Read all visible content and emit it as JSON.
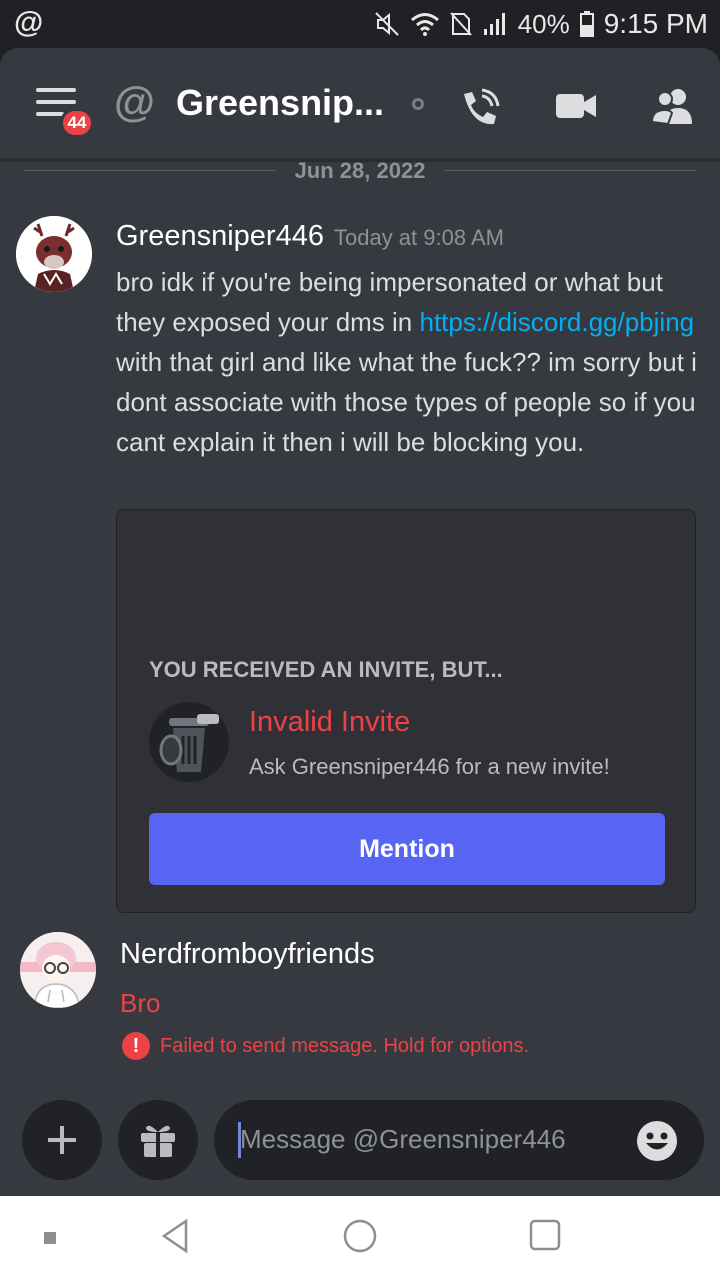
{
  "status_bar": {
    "app_icon": "@",
    "battery": "40%",
    "time": "9:15 PM",
    "icons": [
      "mute-icon",
      "wifi-icon",
      "no-sim-icon",
      "signal-icon",
      "battery-icon"
    ]
  },
  "header": {
    "menu_badge": "44",
    "at_symbol": "@",
    "title": "Greensnip...",
    "icons": [
      "call-icon",
      "video-icon",
      "members-icon"
    ]
  },
  "chat": {
    "date_divider": "Jun 28, 2022",
    "message1": {
      "author": "Greensniper446",
      "timestamp": "Today at 9:08 AM",
      "text_part1": "bro idk if you're being impersonated or what but they exposed your dms in ",
      "link": "https://discord.gg/pbjing",
      "text_part2": " with that girl and like what the fuck?? im sorry but i dont associate with those types of people so if you cant explain it then i will be blocking you."
    },
    "invite": {
      "header": "YOU RECEIVED AN INVITE, BUT...",
      "title": "Invalid Invite",
      "subtitle": "Ask Greensniper446 for a new invite!",
      "button": "Mention"
    },
    "message2": {
      "author": "Nerdfromboyfriends",
      "text": "Bro",
      "error": "Failed to send message. Hold for options."
    }
  },
  "input": {
    "placeholder": "Message @Greensniper446"
  },
  "colors": {
    "background": "#36393f",
    "blurple": "#5865f2",
    "error_red": "#ed4245",
    "link": "#00aff4"
  }
}
